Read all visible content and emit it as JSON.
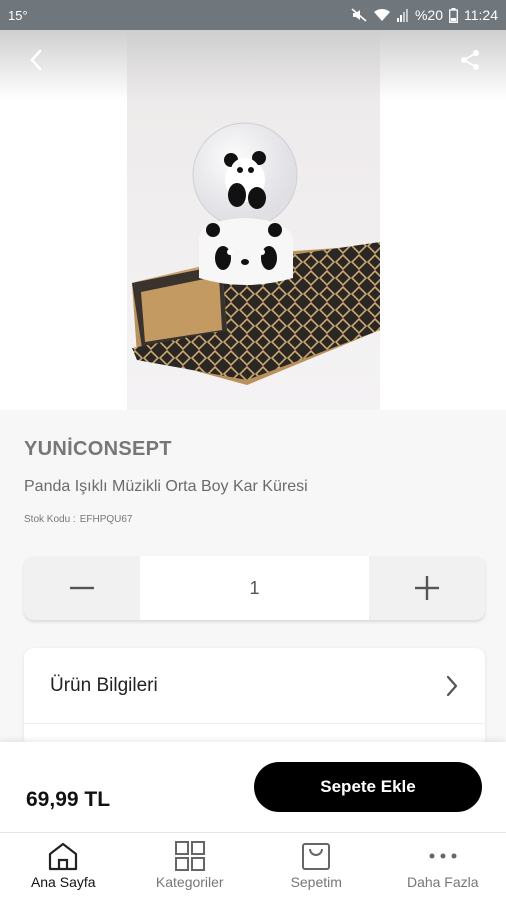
{
  "status_bar": {
    "temperature": "15°",
    "battery": "%20",
    "time": "11:24"
  },
  "product": {
    "brand": "YUNİCONSEPT",
    "name": "Panda Işıklı Müzikli Orta Boy Kar Küresi",
    "stock_label": "Stok Kodu :",
    "stock_code": "EFHPQU67"
  },
  "quantity": {
    "value": "1"
  },
  "info": {
    "label": "Ürün Bilgileri"
  },
  "buy": {
    "price": "69,99 TL",
    "add_to_cart": "Sepete Ekle"
  },
  "nav": {
    "items": [
      {
        "label": "Ana Sayfa",
        "icon": "home-icon"
      },
      {
        "label": "Kategoriler",
        "icon": "grid-icon"
      },
      {
        "label": "Sepetim",
        "icon": "shopping-bag-icon"
      },
      {
        "label": "Daha Fazla",
        "icon": "more-dots-icon"
      }
    ]
  },
  "colors": {
    "status_bar": "#6f767c",
    "button": "#000000",
    "background": "#f7f7f7"
  }
}
